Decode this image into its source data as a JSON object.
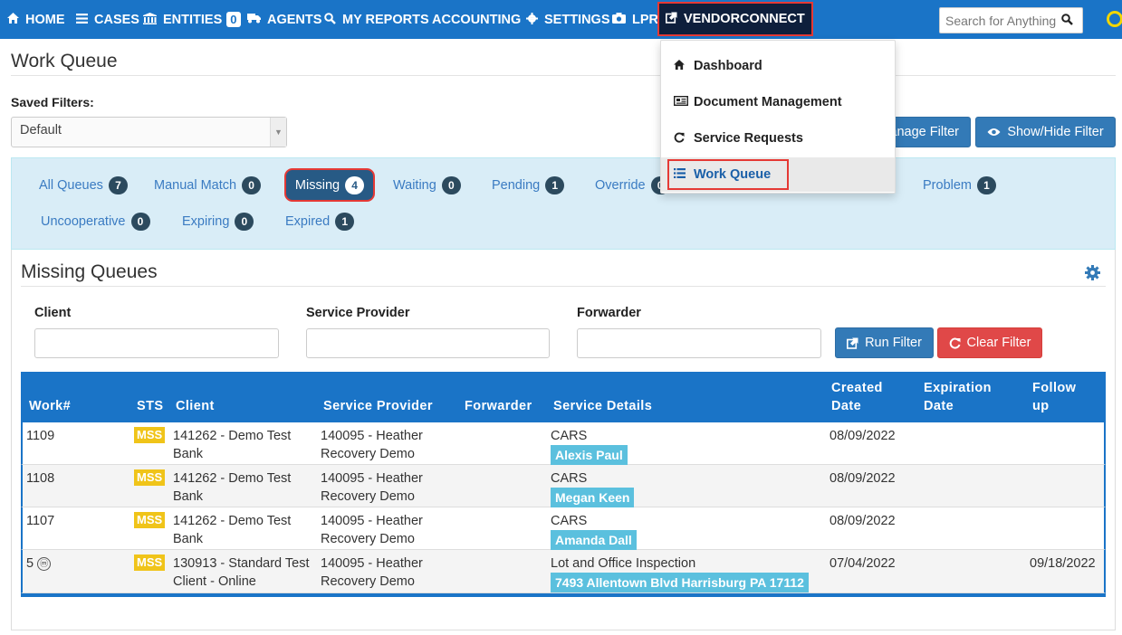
{
  "nav": {
    "home": "HOME",
    "cases": "CASES",
    "entities": "ENTITIES",
    "entities_badge": "0",
    "agents": "AGENTS",
    "reports": "MY REPORTS",
    "accounting": "ACCOUNTING",
    "settings": "SETTINGS",
    "lpr": "LPR",
    "vendorconnect": "VENDORCONNECT",
    "search_placeholder": "Search for Anything"
  },
  "page": {
    "title": "Work Queue",
    "saved_filters_label": "Saved Filters:",
    "saved_filter_value": "Default",
    "manage_filter": "Manage Filter",
    "show_hide_filter": "Show/Hide Filter"
  },
  "queues": [
    {
      "label": "All Queues",
      "count": "7"
    },
    {
      "label": "Manual Match",
      "count": "0"
    },
    {
      "label": "Missing",
      "count": "4"
    },
    {
      "label": "Waiting",
      "count": "0"
    },
    {
      "label": "Pending",
      "count": "1"
    },
    {
      "label": "Override",
      "count": "0"
    },
    {
      "label": "Problem",
      "count": "1"
    },
    {
      "label": "Uncooperative",
      "count": "0"
    },
    {
      "label": "Expiring",
      "count": "0"
    },
    {
      "label": "Expired",
      "count": "1"
    }
  ],
  "section": {
    "title": "Missing Queues",
    "client_label": "Client",
    "provider_label": "Service Provider",
    "forwarder_label": "Forwarder",
    "run_filter": "Run Filter",
    "clear_filter": "Clear Filter"
  },
  "table": {
    "headers": {
      "work": "Work#",
      "sts": "STS",
      "client": "Client",
      "provider": "Service Provider",
      "forwarder": "Forwarder",
      "details": "Service Details",
      "created1": "Created",
      "created2": "Date",
      "expiration1": "Expiration",
      "expiration2": "Date",
      "followup1": "Follow",
      "followup2": "up"
    },
    "rows": [
      {
        "work": "1109",
        "sts": "MSS",
        "client1": "141262 - Demo Test",
        "client2": "Bank",
        "provider1": "140095 - Heather",
        "provider2": "Recovery Demo",
        "detail": "CARS",
        "chip": "Alexis Paul",
        "created": "08/09/2022",
        "followup": ""
      },
      {
        "work": "1108",
        "sts": "MSS",
        "client1": "141262 - Demo Test",
        "client2": "Bank",
        "provider1": "140095 - Heather",
        "provider2": "Recovery Demo",
        "detail": "CARS",
        "chip": "Megan Keen",
        "created": "08/09/2022",
        "followup": ""
      },
      {
        "work": "1107",
        "sts": "MSS",
        "client1": "141262 - Demo Test",
        "client2": "Bank",
        "provider1": "140095 - Heather",
        "provider2": "Recovery Demo",
        "detail": "CARS",
        "chip": "Amanda Dall",
        "created": "08/09/2022",
        "followup": ""
      },
      {
        "work": "5",
        "work_icon": "ⓜ",
        "sts": "MSS",
        "client1": "130913 - Standard Test",
        "client2": "Client - Online",
        "provider1": "140095 - Heather",
        "provider2": "Recovery Demo",
        "detail": "Lot and Office Inspection",
        "chip": "7493 Allentown Blvd Harrisburg PA 17112",
        "created": "07/04/2022",
        "followup": "09/18/2022"
      }
    ]
  },
  "dropdown": {
    "dashboard": "Dashboard",
    "documents": "Document Management",
    "requests": "Service Requests",
    "workqueue": "Work Queue"
  },
  "colors": {
    "nav_blue": "#1a74c7",
    "highlight_red": "#e53935",
    "status_yellow": "#f0c419",
    "chip_cyan": "#5bc0de"
  }
}
